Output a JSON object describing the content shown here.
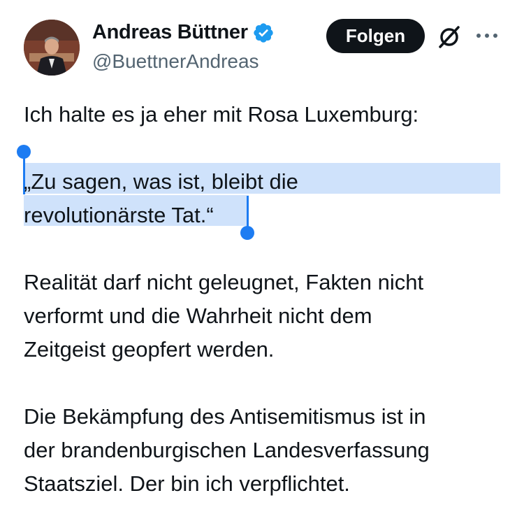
{
  "author": {
    "name": "Andreas Büttner",
    "handle": "@BuettnerAndreas",
    "verified": true,
    "avatar_icon": "profile-photo"
  },
  "actions": {
    "follow_label": "Folgen",
    "grok_icon": "grok-icon",
    "more_icon": "more-options-icon"
  },
  "tweet": {
    "paragraph1": "Ich halte es ja eher mit Rosa Luxemburg:",
    "quote_line1": "„Zu sagen, was ist, bleibt die",
    "quote_line2": "revolutionärste Tat.“",
    "paragraph3": "Realität darf nicht geleugnet, Fakten nicht\nverformt und die Wahrheit nicht dem\nZeitgeist geopfert werden.",
    "paragraph4": "Die Bekämpfung des Antisemitismus ist in\nder brandenburgischen Landesverfassung\nStaatsziel. Der bin ich verpflichtet."
  },
  "colors": {
    "text": "#0f1419",
    "secondary": "#536471",
    "verified_blue": "#1d9bf0",
    "selection_highlight": "#cfe2fb",
    "selection_handle": "#1d7cf2"
  }
}
